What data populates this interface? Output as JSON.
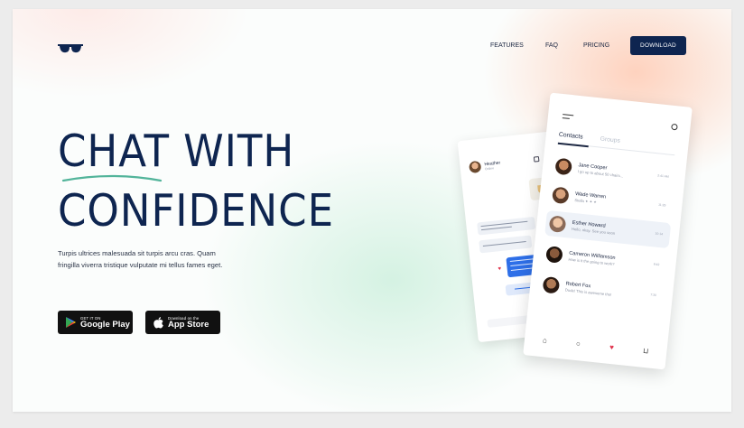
{
  "colors": {
    "navy": "#0e2550",
    "accent_green": "#52b49a",
    "bubble_blue": "#2e6fe8",
    "heart_red": "#e0334c"
  },
  "logo": {
    "icon": "sunglasses-icon"
  },
  "nav": {
    "features": "FEATURES",
    "faq": "FAQ",
    "pricing": "PRICING",
    "download": "DOWNLOAD"
  },
  "hero": {
    "line1": "CHAT WITH",
    "line2": "CONFIDENCE",
    "desc_line1": "Turpis ultrices malesuada sit turpis arcu cras. Quam",
    "desc_line2": "fringilla viverra tristique vulputate mi tellus fames eget."
  },
  "stores": {
    "google_small": "GET IT ON",
    "google_big": "Google Play",
    "apple_small": "Download on the",
    "apple_big": "App Store"
  },
  "chat_phone": {
    "name": "Heather",
    "status": "Online"
  },
  "contacts_phone": {
    "tab_contacts": "Contacts",
    "tab_groups": "Groups",
    "contacts": [
      {
        "name": "Jane Cooper",
        "message": "I go up to about 50 chairs...",
        "time": "2:41 AM"
      },
      {
        "name": "Wade Warren",
        "message": "Stella ✦ ✦ ✦",
        "time": "11:29"
      },
      {
        "name": "Esther Howard",
        "message": "Hello, okay. See you soon",
        "time": "10:14"
      },
      {
        "name": "Cameron Williamson",
        "message": "How is it the going to work?",
        "time": "8:42"
      },
      {
        "name": "Robert Fox",
        "message": "Dude! This is awesome tho!",
        "time": "7:30"
      }
    ]
  }
}
